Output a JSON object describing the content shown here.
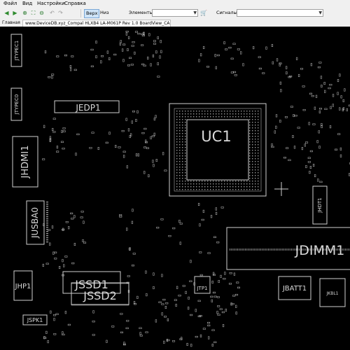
{
  "menu": [
    "Файл",
    "Вид",
    "Настройки",
    "Справка"
  ],
  "toolbar": {
    "view_top": "Верх",
    "view_bottom": "Низ",
    "elements_label": "Элементы:",
    "signals_label": "Сигналы:",
    "elements_value": "",
    "signals_value": ""
  },
  "tabs": {
    "home": "Главная",
    "file": "www.DeviceDB.xyz_Compal HLXB4 LA-M061P Rev 1.0 BoardView_CAD_"
  },
  "board": {
    "labels": {
      "uc1": "UC1",
      "jedp1": "JEDP1",
      "jhdmi1": "JHDMI1",
      "jusba0": "JUSBA0",
      "jdimm1": "JDIMM1",
      "jssd1": "JSSD1",
      "jssd2": "JSSD2",
      "jhp1": "JHP1",
      "jbatt1": "JBATT1",
      "jtp1": "JTP1",
      "jspk1": "JSPK1",
      "jtypec1": "JTYPEC1",
      "jtypec0": "JTYPEC0",
      "jhdt1": "JHDT1",
      "jkbl1": "JKBL1"
    }
  },
  "colors": {
    "canvas": "#000000",
    "outline": "#d0d0d0",
    "accent": "#cfe4f7"
  }
}
